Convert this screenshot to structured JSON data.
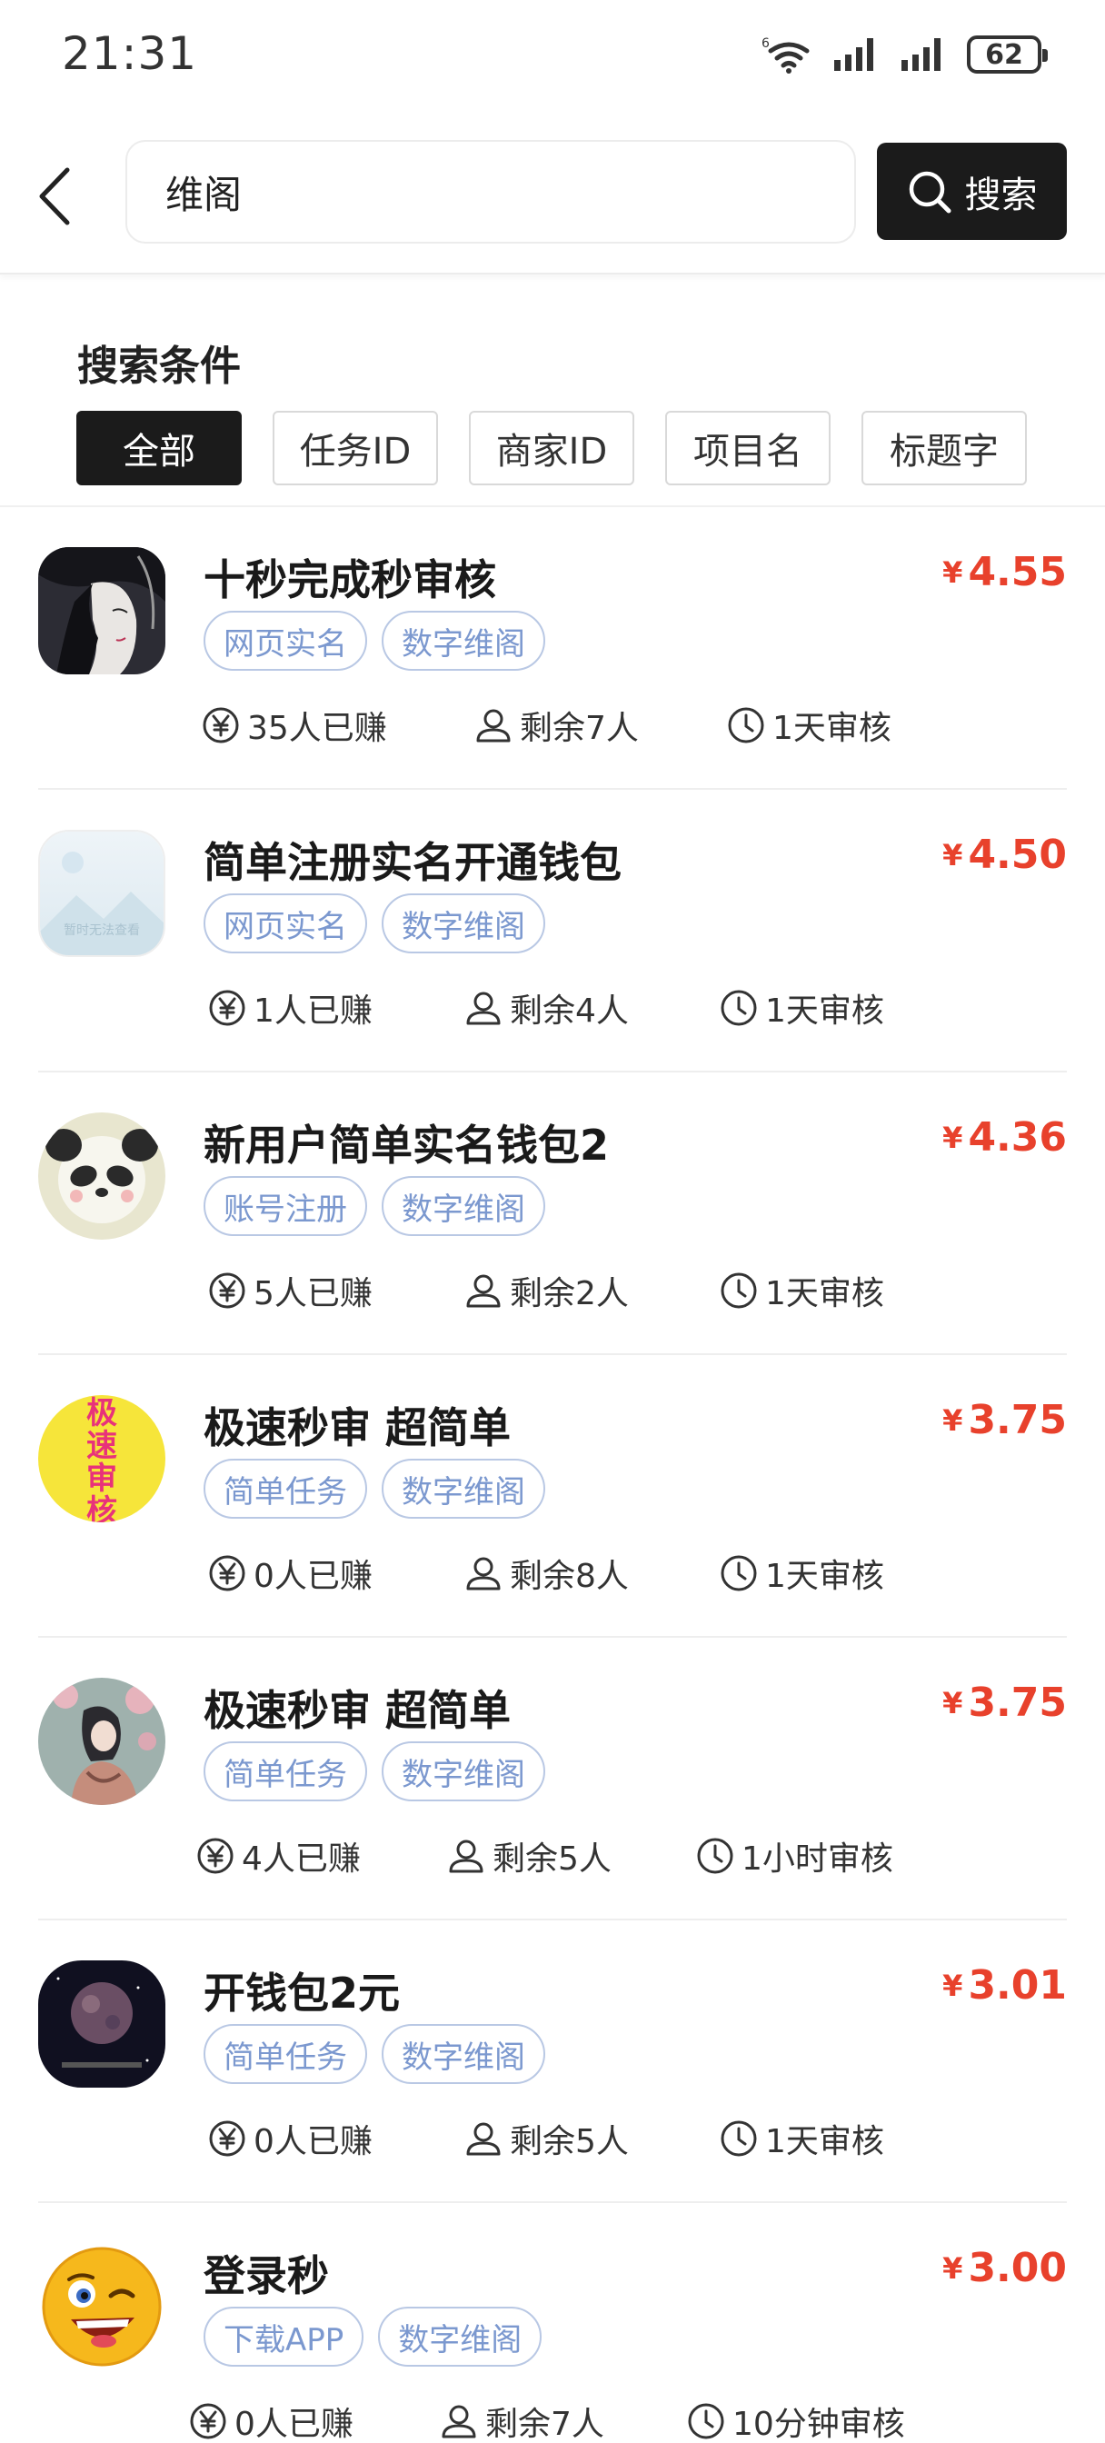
{
  "status_bar": {
    "time": "21:31",
    "battery": "62"
  },
  "search": {
    "query": "维阁",
    "button_label": "搜索"
  },
  "filters": {
    "title": "搜索条件",
    "options": [
      "全部",
      "任务ID",
      "商家ID",
      "项目名",
      "标题字"
    ],
    "selected": "全部"
  },
  "tasks": [
    {
      "title": "十秒完成秒审核",
      "currency": "¥",
      "price": "4.55",
      "tags": [
        "网页实名",
        "数字维阁"
      ],
      "earned": "35人已赚",
      "remaining": "剩余7人",
      "review": "1天审核"
    },
    {
      "title": "简单注册实名开通钱包",
      "currency": "¥",
      "price": "4.50",
      "tags": [
        "网页实名",
        "数字维阁"
      ],
      "earned": "1人已赚",
      "remaining": "剩余4人",
      "review": "1天审核",
      "avatar_text": "暂时无法查看"
    },
    {
      "title": "新用户简单实名钱包2",
      "currency": "¥",
      "price": "4.36",
      "tags": [
        "账号注册",
        "数字维阁"
      ],
      "earned": "5人已赚",
      "remaining": "剩余2人",
      "review": "1天审核"
    },
    {
      "title": "极速秒审 超简单",
      "currency": "¥",
      "price": "3.75",
      "tags": [
        "简单任务",
        "数字维阁"
      ],
      "earned": "0人已赚",
      "remaining": "剩余8人",
      "review": "1天审核",
      "avatar_text": "极速审核"
    },
    {
      "title": "极速秒审 超简单",
      "currency": "¥",
      "price": "3.75",
      "tags": [
        "简单任务",
        "数字维阁"
      ],
      "earned": "4人已赚",
      "remaining": "剩余5人",
      "review": "1小时审核"
    },
    {
      "title": "开钱包2元",
      "currency": "¥",
      "price": "3.01",
      "tags": [
        "简单任务",
        "数字维阁"
      ],
      "earned": "0人已赚",
      "remaining": "剩余5人",
      "review": "1天审核"
    },
    {
      "title": "登录秒",
      "currency": "¥",
      "price": "3.00",
      "tags": [
        "下载APP",
        "数字维阁"
      ],
      "earned": "0人已赚",
      "remaining": "剩余7人",
      "review": "10分钟审核"
    }
  ],
  "colors": {
    "price": "#e8412c",
    "tag": "#7b98cf",
    "primary": "#1b1b1b"
  }
}
